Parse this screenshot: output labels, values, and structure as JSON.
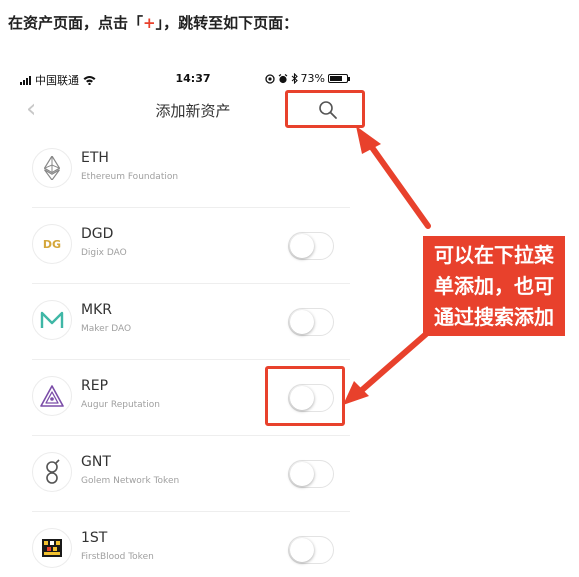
{
  "caption": {
    "before": "在资产页面，点击「",
    "plus": "+",
    "after": "」，跳转至如下页面："
  },
  "status_bar": {
    "carrier": "中国联通",
    "time": "14:37",
    "battery": "73%",
    "battery_level": 0.73,
    "icons": [
      "signal-icon",
      "wifi-icon",
      "location-icon",
      "alarm-icon",
      "bluetooth-icon",
      "battery-icon"
    ]
  },
  "navbar": {
    "back_icon": "chevron-left-icon",
    "title": "添加新资产",
    "search_icon": "search-icon"
  },
  "assets": [
    {
      "symbol": "ETH",
      "name": "Ethereum Foundation",
      "has_toggle": false,
      "icon": "ethereum-logo"
    },
    {
      "symbol": "DGD",
      "name": "Digix DAO",
      "has_toggle": true,
      "enabled": false,
      "icon": "digix-logo"
    },
    {
      "symbol": "MKR",
      "name": "Maker DAO",
      "has_toggle": true,
      "enabled": false,
      "icon": "maker-logo"
    },
    {
      "symbol": "REP",
      "name": "Augur Reputation",
      "has_toggle": true,
      "enabled": false,
      "icon": "augur-logo"
    },
    {
      "symbol": "GNT",
      "name": "Golem Network Token",
      "has_toggle": true,
      "enabled": false,
      "icon": "golem-logo"
    },
    {
      "symbol": "1ST",
      "name": "FirstBlood Token",
      "has_toggle": true,
      "enabled": false,
      "icon": "firstblood-logo"
    }
  ],
  "annotation": {
    "lines": [
      "可以在下拉菜",
      "单添加，也可",
      "通过搜索添加"
    ]
  },
  "colors": {
    "accent_red": "#e8412c",
    "divider": "#eeeeee",
    "subtitle": "#a0a0a0",
    "digix_gold": "#d4a63a",
    "maker_teal": "#3fb7a6",
    "augur_purple": "#7b4da8"
  }
}
